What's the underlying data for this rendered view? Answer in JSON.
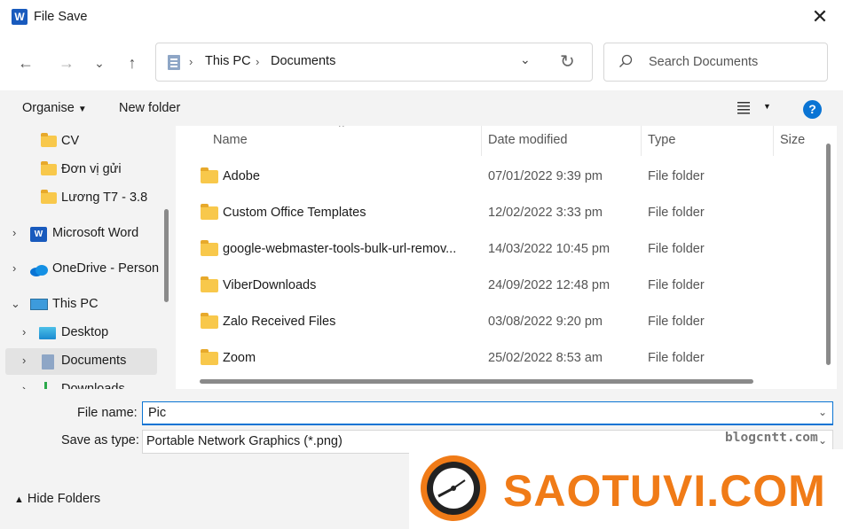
{
  "window": {
    "title": "File Save",
    "app_icon": "word-icon",
    "close_label": "✕"
  },
  "nav": {
    "back": "←",
    "forward": "→",
    "recent": "⌄",
    "up": "↑",
    "breadcrumb": [
      "This PC",
      "Documents"
    ],
    "search_placeholder": "Search Documents"
  },
  "toolbar": {
    "organise": "Organise",
    "new_folder": "New folder",
    "help": "?"
  },
  "sidebar": {
    "items": [
      {
        "label": "CV",
        "icon": "folder-icon",
        "expandable": false
      },
      {
        "label": "Đơn vị gửi",
        "icon": "folder-icon",
        "expandable": false
      },
      {
        "label": "Lương T7 - 3.8",
        "icon": "folder-icon",
        "expandable": false
      },
      {
        "label": "Microsoft Word",
        "icon": "word-icon",
        "expandable": true
      },
      {
        "label": "OneDrive - Person",
        "icon": "onedrive-icon",
        "expandable": true
      },
      {
        "label": "This PC",
        "icon": "pc-icon",
        "expandable": true,
        "expanded": true
      },
      {
        "label": "Desktop",
        "icon": "desktop-icon",
        "expandable": true
      },
      {
        "label": "Documents",
        "icon": "documents-icon",
        "expandable": true,
        "selected": true
      },
      {
        "label": "Downloads",
        "icon": "downloads-icon",
        "expandable": true
      }
    ]
  },
  "files": {
    "columns": [
      "Name",
      "Date modified",
      "Type",
      "Size"
    ],
    "rows": [
      {
        "name": "Adobe",
        "date": "07/01/2022 9:39 pm",
        "type": "File folder"
      },
      {
        "name": "Custom Office Templates",
        "date": "12/02/2022 3:33 pm",
        "type": "File folder"
      },
      {
        "name": "google-webmaster-tools-bulk-url-remov...",
        "date": "14/03/2022 10:45 pm",
        "type": "File folder"
      },
      {
        "name": "ViberDownloads",
        "date": "24/09/2022 12:48 pm",
        "type": "File folder"
      },
      {
        "name": "Zalo Received Files",
        "date": "03/08/2022 9:20 pm",
        "type": "File folder"
      },
      {
        "name": "Zoom",
        "date": "25/02/2022 8:53 am",
        "type": "File folder"
      }
    ]
  },
  "save": {
    "filename_label": "File name:",
    "filename_value": "Pic",
    "type_label": "Save as type:",
    "type_value": "Portable Network Graphics (*.png)",
    "hide_folders": "Hide Folders"
  },
  "watermark": {
    "small": "blogcntt.com",
    "brand": "SAOTUVI.COM"
  },
  "colors": {
    "accent": "#0a74d4",
    "folder": "#f8c84b",
    "brand": "#f07b17"
  }
}
